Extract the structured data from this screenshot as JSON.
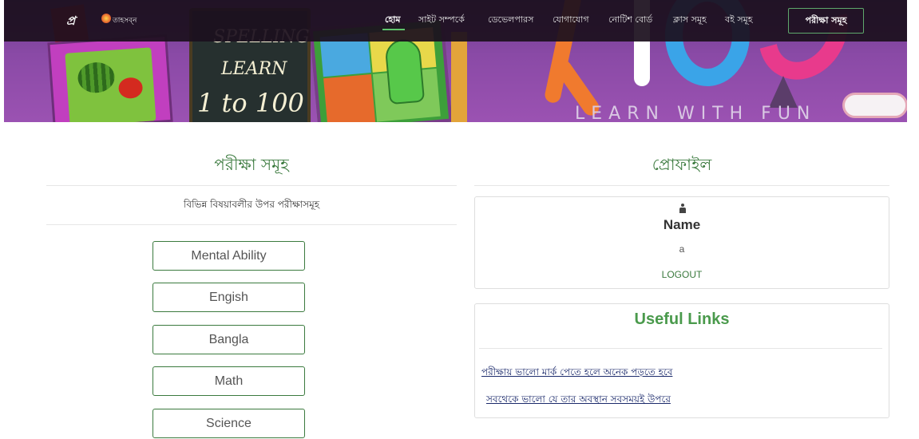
{
  "colors": {
    "green": "#3b7a3e",
    "nav_bg": "#1c101e",
    "banner": "#8a4aa6",
    "link": "#1b2a6b"
  },
  "navbar": {
    "logo": {
      "mark": "প্র",
      "text": "তাহসব্ন"
    },
    "items": [
      {
        "label": "হোম",
        "active": true
      },
      {
        "label": "সাইট সম্পর্কে",
        "active": false
      },
      {
        "label": "ডেভেলপারস",
        "active": false
      },
      {
        "label": "যোগাযোগ",
        "active": false
      },
      {
        "label": "নোটিশ বোর্ড",
        "active": false
      },
      {
        "label": "ক্লাস সমূহ",
        "active": false
      },
      {
        "label": "বই সমূহ",
        "active": false
      }
    ],
    "button_label": "পরীক্ষা সমূহ"
  },
  "banner": {
    "board_lines": [
      "SPELLING",
      "LEARN",
      "1 to 100"
    ],
    "tagline": "LEARN WITH FUN"
  },
  "exams": {
    "title": "পরীক্ষা সমূহ",
    "subtitle": "বিভিন্ন বিষয়াবলীর উপর পরীক্ষাসমূহ",
    "buttons": [
      "Mental Ability",
      "Engish",
      "Bangla",
      "Math",
      "Science"
    ]
  },
  "profile": {
    "title": "প্রোফাইল",
    "icon": "user-icon",
    "name_label": "Name",
    "name_value": "a",
    "logout_label": "LOGOUT"
  },
  "useful_links": {
    "title": "Useful Links",
    "links": [
      "পরীক্ষায় ভালো মার্ক পেতে হলে অনেক পড়তে হবে",
      "সবথেকে ভালো যে তার অবস্থান সবসময়ই উপরে"
    ]
  }
}
